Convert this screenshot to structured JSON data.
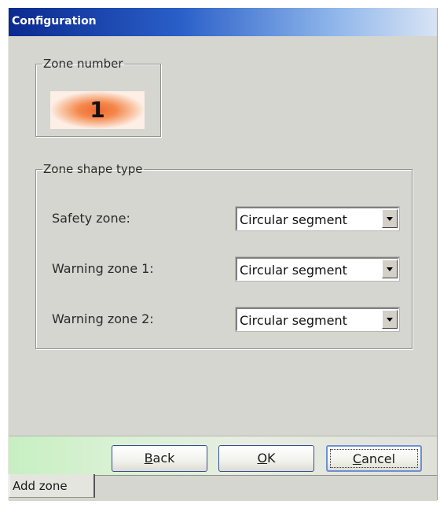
{
  "window": {
    "title": "Configuration"
  },
  "zone_number": {
    "legend": "Zone number",
    "value": "1"
  },
  "zone_shape": {
    "legend": "Zone shape type",
    "rows": [
      {
        "label": "Safety zone:",
        "value": "Circular segment"
      },
      {
        "label": "Warning zone 1:",
        "value": "Circular segment"
      },
      {
        "label": "Warning zone 2:",
        "value": "Circular segment"
      }
    ]
  },
  "buttons": {
    "back_first": "B",
    "back_rest": "ack",
    "ok_first": "O",
    "ok_rest": "K",
    "cancel_first": "C",
    "cancel_rest": "ancel"
  },
  "tabs": [
    {
      "label": "Add zone"
    }
  ],
  "colors": {
    "title_bar_start": "#0b2a8f",
    "zone_highlight": "#f06a2f",
    "dialog_background": "#d4d6cf"
  }
}
